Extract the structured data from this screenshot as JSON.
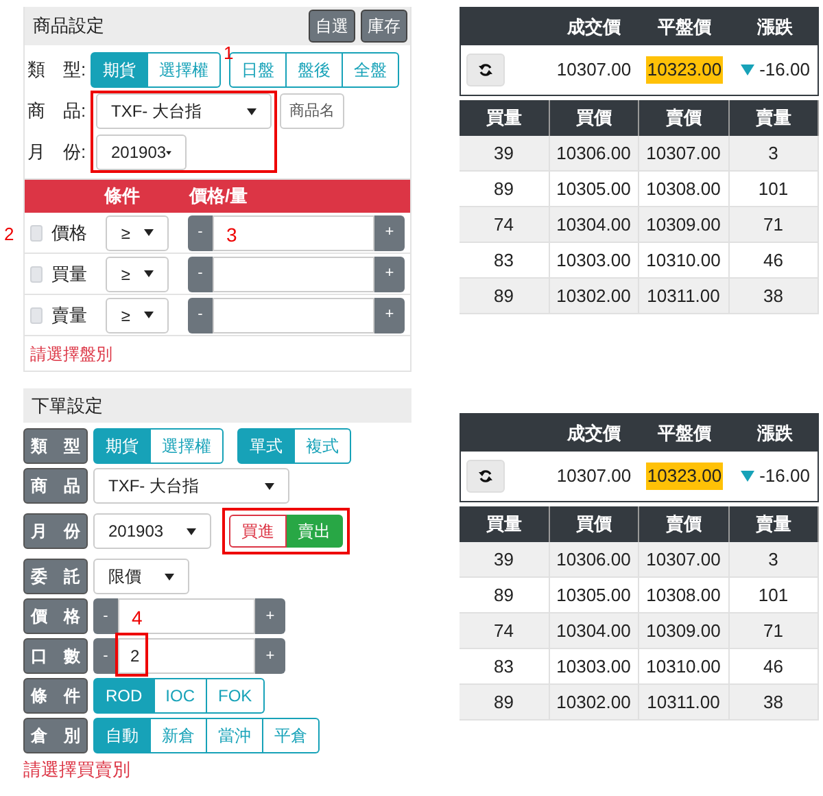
{
  "product_panel": {
    "title": "商品設定",
    "annotation": "1",
    "buttons": [
      "自選",
      "庫存"
    ],
    "type_label": "類　型:",
    "type_options": [
      {
        "label": "期貨",
        "selected": true
      },
      {
        "label": "選擇權",
        "selected": false
      }
    ],
    "session_options": [
      {
        "label": "日盤",
        "selected": false
      },
      {
        "label": "盤後",
        "selected": false
      },
      {
        "label": "全盤",
        "selected": false
      }
    ],
    "product_label": "商　品:",
    "product": "TXF- 大台指",
    "product_name_button": "商品名",
    "month_label": "月　份:",
    "month": "201903"
  },
  "condition_table": {
    "annotation": "2",
    "columns": [
      "條件",
      "價格/量"
    ],
    "rows": [
      {
        "label": "價格",
        "checked": false,
        "operator": "≥",
        "minus": "-",
        "plus": "+",
        "annotation": "3"
      },
      {
        "label": "買量",
        "checked": false,
        "operator": "≥",
        "minus": "-",
        "plus": "+"
      },
      {
        "label": "賣量",
        "checked": false,
        "operator": "≥",
        "minus": "-",
        "plus": "+"
      }
    ],
    "message": "請選擇盤別"
  },
  "order_panel": {
    "title": "下單設定",
    "type_label": "類　型",
    "type_options": [
      {
        "label": "期貨",
        "selected": true
      },
      {
        "label": "選擇權",
        "selected": false
      }
    ],
    "form_options": [
      {
        "label": "單式",
        "selected": true
      },
      {
        "label": "複式",
        "selected": false
      }
    ],
    "product_label": "商　品",
    "product": "TXF- 大台指",
    "month_label": "月　份",
    "month": "201903",
    "side_options": [
      {
        "label": "買進",
        "selected": false,
        "color": "#dc3545"
      },
      {
        "label": "賣出",
        "selected": true,
        "color": "#28a745"
      }
    ],
    "order_type_label": "委　託",
    "order_type": "限價",
    "price_label": "價　格",
    "price_minus": "-",
    "price_plus": "+",
    "price_annotation": "4",
    "qty_label": "口　數",
    "qty_minus": "-",
    "qty_plus": "+",
    "qty": "2",
    "condition_label": "條　件",
    "condition_options": [
      {
        "label": "ROD",
        "selected": true
      },
      {
        "label": "IOC",
        "selected": false
      },
      {
        "label": "FOK",
        "selected": false
      }
    ],
    "position_label": "倉　別",
    "position_options": [
      {
        "label": "自動",
        "selected": true
      },
      {
        "label": "新倉",
        "selected": false
      },
      {
        "label": "當沖",
        "selected": false
      },
      {
        "label": "平倉",
        "selected": false
      }
    ],
    "message": "請選擇買賣別"
  },
  "quote_panels": [
    {
      "headers": [
        "成交價",
        "平盤價",
        "漲跌"
      ],
      "last": "10307.00",
      "reference": "10323.00",
      "change": "-16.00",
      "book_columns": [
        "買量",
        "買價",
        "賣價",
        "賣量"
      ],
      "book_rows": [
        [
          "39",
          "10306.00",
          "10307.00",
          "3"
        ],
        [
          "89",
          "10305.00",
          "10308.00",
          "101"
        ],
        [
          "74",
          "10304.00",
          "10309.00",
          "71"
        ],
        [
          "83",
          "10303.00",
          "10310.00",
          "46"
        ],
        [
          "89",
          "10302.00",
          "10311.00",
          "38"
        ]
      ]
    },
    {
      "headers": [
        "成交價",
        "平盤價",
        "漲跌"
      ],
      "last": "10307.00",
      "reference": "10323.00",
      "change": "-16.00",
      "book_columns": [
        "買量",
        "買價",
        "賣價",
        "賣量"
      ],
      "book_rows": [
        [
          "39",
          "10306.00",
          "10307.00",
          "3"
        ],
        [
          "89",
          "10305.00",
          "10308.00",
          "101"
        ],
        [
          "74",
          "10304.00",
          "10309.00",
          "71"
        ],
        [
          "83",
          "10303.00",
          "10310.00",
          "46"
        ],
        [
          "89",
          "10302.00",
          "10311.00",
          "38"
        ]
      ]
    }
  ]
}
